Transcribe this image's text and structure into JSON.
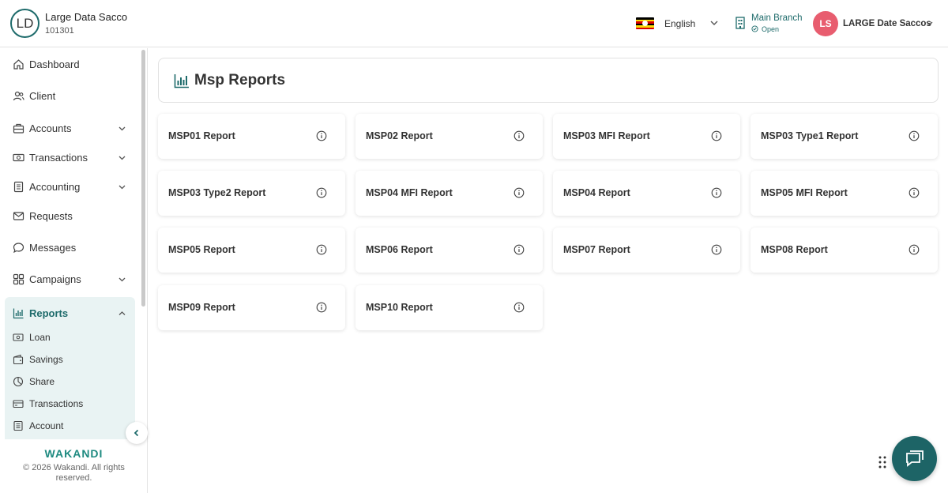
{
  "header": {
    "org_initials": "LD",
    "org_name": "Large Data Sacco",
    "org_code": "101301",
    "language": "English",
    "branch_name": "Main Branch",
    "branch_status": "Open",
    "user_initials": "LS",
    "user_name": "LARGE Date Saccos",
    "colors": {
      "accent": "#1e6b6b",
      "avatar": "#e85d6f"
    }
  },
  "sidebar": {
    "items": [
      {
        "label": "Dashboard",
        "icon": "home-icon"
      },
      {
        "label": "Client",
        "icon": "users-icon"
      },
      {
        "label": "Accounts",
        "icon": "briefcase-icon"
      },
      {
        "label": "Transactions",
        "icon": "money-icon"
      },
      {
        "label": "Accounting",
        "icon": "ledger-icon"
      },
      {
        "label": "Requests",
        "icon": "mail-icon"
      },
      {
        "label": "Messages",
        "icon": "message-icon"
      },
      {
        "label": "Campaigns",
        "icon": "grid-icon"
      },
      {
        "label": "Reports",
        "icon": "chart-icon"
      }
    ],
    "report_sub_items": [
      {
        "label": "Loan",
        "icon": "money-icon"
      },
      {
        "label": "Savings",
        "icon": "wallet-icon"
      },
      {
        "label": "Share",
        "icon": "pie-icon"
      },
      {
        "label": "Transactions",
        "icon": "card-icon"
      },
      {
        "label": "Account",
        "icon": "ledger-icon"
      }
    ],
    "brand": "WAKANDI",
    "copyright": "© 2026 Wakandi. All rights reserved."
  },
  "main": {
    "title": "Msp Reports",
    "reports": [
      "MSP01 Report",
      "MSP02 Report",
      "MSP03 MFI Report",
      "MSP03 Type1 Report",
      "MSP03 Type2 Report",
      "MSP04 MFI Report",
      "MSP04 Report",
      "MSP05 MFI Report",
      "MSP05 Report",
      "MSP06 Report",
      "MSP07 Report",
      "MSP08 Report",
      "MSP09 Report",
      "MSP10 Report"
    ]
  }
}
